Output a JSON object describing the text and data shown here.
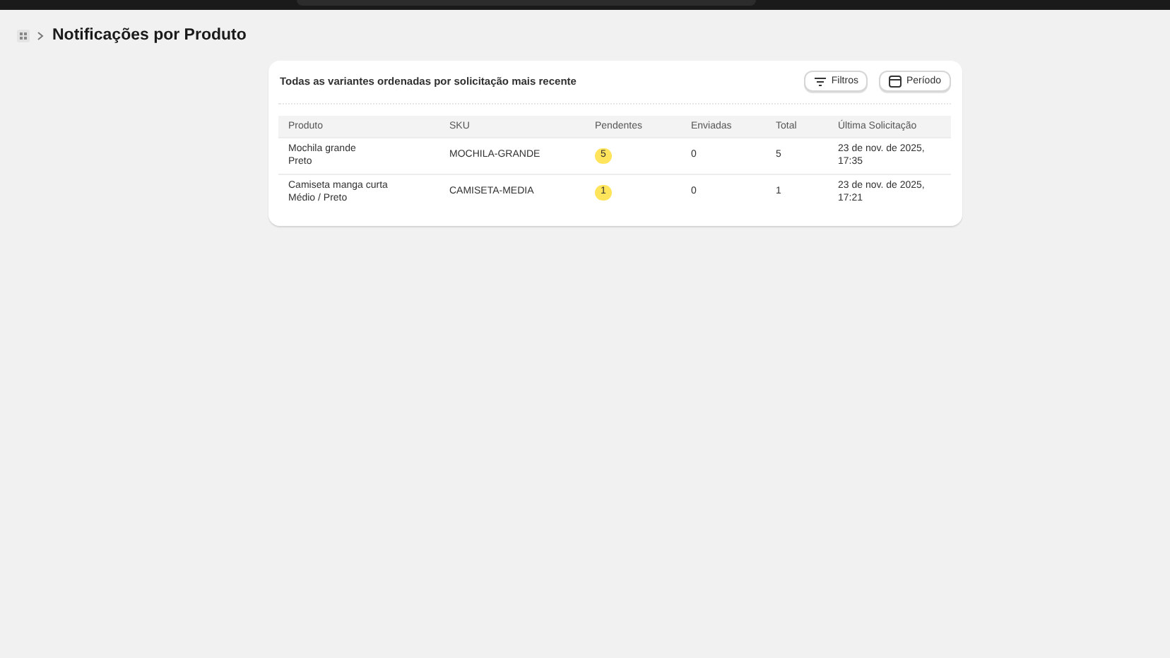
{
  "breadcrumb": {
    "title": "Notificações por Produto"
  },
  "card": {
    "subtitle": "Todas as variantes ordenadas por solicitação mais recente",
    "buttons": [
      {
        "label": "Filtros",
        "kind": "filter"
      },
      {
        "label": "Período",
        "kind": "calendar"
      }
    ]
  },
  "table": {
    "columns": [
      "Produto",
      "SKU",
      "Pendentes",
      "Enviadas",
      "Total",
      "Última Solicitação"
    ],
    "rows": [
      {
        "product": "Mochila grande",
        "variant": "Preto",
        "sku": "MOCHILA-GRANDE",
        "pending": "5",
        "sent": "0",
        "total": "5",
        "last": "23 de nov. de 2025, 17:35"
      },
      {
        "product": "Camiseta manga curta",
        "variant": "Médio / Preto",
        "sku": "CAMISETA-MEDIA",
        "pending": "1",
        "sent": "0",
        "total": "1",
        "last": "23 de nov. de 2025, 17:21"
      }
    ]
  }
}
